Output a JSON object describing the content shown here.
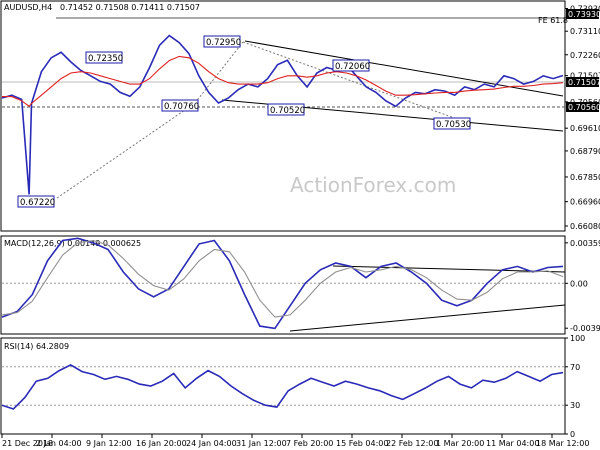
{
  "chart_data": [
    {
      "type": "line",
      "panel": "price",
      "title": "AUDUSD,H4",
      "ohlc_text": "0.71452 0.71508 0.71411 0.71507",
      "watermark": "ActionForex.com",
      "ylim": [
        0.659,
        0.742
      ],
      "yticks": [
        "0.73930",
        "0.73110",
        "0.72260",
        "0.71507",
        "0.70560",
        "0.69610",
        "0.68790",
        "0.67850",
        "0.66960",
        "0.66080"
      ],
      "ytick_values": [
        0.7393,
        0.7311,
        0.7226,
        0.71507,
        0.7056,
        0.6961,
        0.6879,
        0.6785,
        0.6696,
        0.6608
      ],
      "x_ticks": [
        "21 Dec 2018",
        "2 Jan 04:00",
        "9 Jan 12:00",
        "16 Jan 20:00",
        "24 Jan 04:00",
        "31 Jan 12:00",
        "7 Feb 20:00",
        "15 Feb 04:00",
        "22 Feb 12:00",
        "1 Mar 20:00",
        "11 Mar 04:00",
        "18 Mar 12:00"
      ],
      "x": [
        0,
        4,
        8,
        11,
        12,
        16,
        20,
        24,
        28,
        32,
        36,
        40,
        44,
        48,
        52,
        56,
        60,
        64,
        68,
        72,
        76,
        80,
        84,
        88,
        92,
        96,
        100,
        104,
        108,
        112,
        116,
        120,
        124,
        128,
        132,
        136,
        140,
        144,
        148,
        152,
        156,
        160,
        164,
        168,
        172,
        176,
        180,
        184,
        188,
        192,
        196,
        200,
        204,
        208,
        212,
        216,
        220,
        224,
        228
      ],
      "series": [
        {
          "name": "",
          "color": "#2a2ab8",
          "values": [
            0.707,
            0.708,
            0.7065,
            0.6722,
            0.705,
            0.7165,
            0.7215,
            0.7235,
            0.72,
            0.717,
            0.715,
            0.713,
            0.712,
            0.709,
            0.7076,
            0.711,
            0.718,
            0.726,
            0.7295,
            0.727,
            0.723,
            0.715,
            0.709,
            0.7052,
            0.707,
            0.71,
            0.712,
            0.711,
            0.714,
            0.719,
            0.7206,
            0.715,
            0.711,
            0.716,
            0.718,
            0.717,
            0.719,
            0.715,
            0.711,
            0.709,
            0.706,
            0.704,
            0.707,
            0.709,
            0.7085,
            0.71,
            0.7095,
            0.708,
            0.711,
            0.71,
            0.712,
            0.711,
            0.715,
            0.714,
            0.712,
            0.713,
            0.715,
            0.714,
            0.7151
          ]
        },
        {
          "name": "",
          "color": "#e02020",
          "values": [
            0.7075,
            0.7075,
            0.706,
            0.704,
            0.705,
            0.708,
            0.711,
            0.714,
            0.716,
            0.7165,
            0.716,
            0.715,
            0.714,
            0.713,
            0.712,
            0.712,
            0.714,
            0.7175,
            0.7205,
            0.722,
            0.7215,
            0.7195,
            0.7165,
            0.714,
            0.7125,
            0.712,
            0.712,
            0.712,
            0.7125,
            0.714,
            0.715,
            0.715,
            0.7145,
            0.715,
            0.716,
            0.7165,
            0.716,
            0.715,
            0.7135,
            0.7115,
            0.7095,
            0.708,
            0.708,
            0.7082,
            0.7085,
            0.7088,
            0.709,
            0.709,
            0.7095,
            0.7098,
            0.71,
            0.7102,
            0.7108,
            0.7112,
            0.7112,
            0.7115,
            0.712,
            0.7122,
            0.7125
          ]
        }
      ],
      "annotations": [
        "0.72350",
        "0.72950",
        "0.72060",
        "0.70760",
        "0.70520",
        "0.70530",
        "0.67220",
        "FE 61.8"
      ],
      "last_price": "0.71507",
      "support": "0.70560"
    },
    {
      "type": "line",
      "panel": "macd",
      "title": "MACD(12,26,9) 0.00149 0.000625",
      "ylim": [
        -0.0045,
        0.0042
      ],
      "yticks": [
        "0.003592",
        "0.00",
        "-0.003986"
      ],
      "ytick_values": [
        0.003592,
        0.0,
        -0.003986
      ],
      "series": [
        {
          "name": "",
          "color": "#2a2ab8",
          "values": [
            -0.003,
            -0.0025,
            -0.001,
            0.002,
            0.0038,
            0.004,
            0.0036,
            0.003,
            0.001,
            -0.0005,
            -0.0012,
            -0.0005,
            0.0015,
            0.0035,
            0.0038,
            0.002,
            -0.001,
            -0.0038,
            -0.004,
            -0.002,
            0.0,
            0.0012,
            0.0018,
            0.0015,
            0.0005,
            0.0015,
            0.0018,
            0.001,
            0.0,
            -0.0015,
            -0.002,
            -0.0015,
            0.0,
            0.0012,
            0.0015,
            0.001,
            0.0014,
            0.0015
          ]
        },
        {
          "name": "",
          "color": "#909090",
          "values": [
            -0.0028,
            -0.0026,
            -0.0016,
            0.0005,
            0.0025,
            0.0036,
            0.0038,
            0.0034,
            0.0022,
            0.0008,
            -0.0002,
            -0.0006,
            0.0004,
            0.002,
            0.003,
            0.0028,
            0.001,
            -0.0015,
            -0.003,
            -0.0028,
            -0.0015,
            0.0,
            0.001,
            0.0014,
            0.001,
            0.0012,
            0.0015,
            0.0012,
            0.0005,
            -0.0006,
            -0.0014,
            -0.0015,
            -0.0008,
            0.0004,
            0.001,
            0.001,
            0.0011,
            0.0006
          ]
        }
      ]
    },
    {
      "type": "line",
      "panel": "rsi",
      "title": "RSI(14) 64.2809",
      "ylim": [
        0,
        100
      ],
      "yticks": [
        "100",
        "70",
        "30",
        "0"
      ],
      "ytick_values": [
        100,
        70,
        30,
        0
      ],
      "series": [
        {
          "name": "",
          "color": "#2a2ab8",
          "values": [
            30,
            26,
            38,
            55,
            58,
            66,
            72,
            65,
            62,
            57,
            60,
            57,
            52,
            50,
            55,
            63,
            48,
            58,
            66,
            60,
            50,
            42,
            35,
            30,
            28,
            45,
            52,
            58,
            54,
            50,
            55,
            52,
            48,
            45,
            40,
            36,
            42,
            48,
            55,
            60,
            52,
            48,
            56,
            54,
            58,
            65,
            60,
            55,
            62,
            64
          ]
        }
      ]
    }
  ]
}
